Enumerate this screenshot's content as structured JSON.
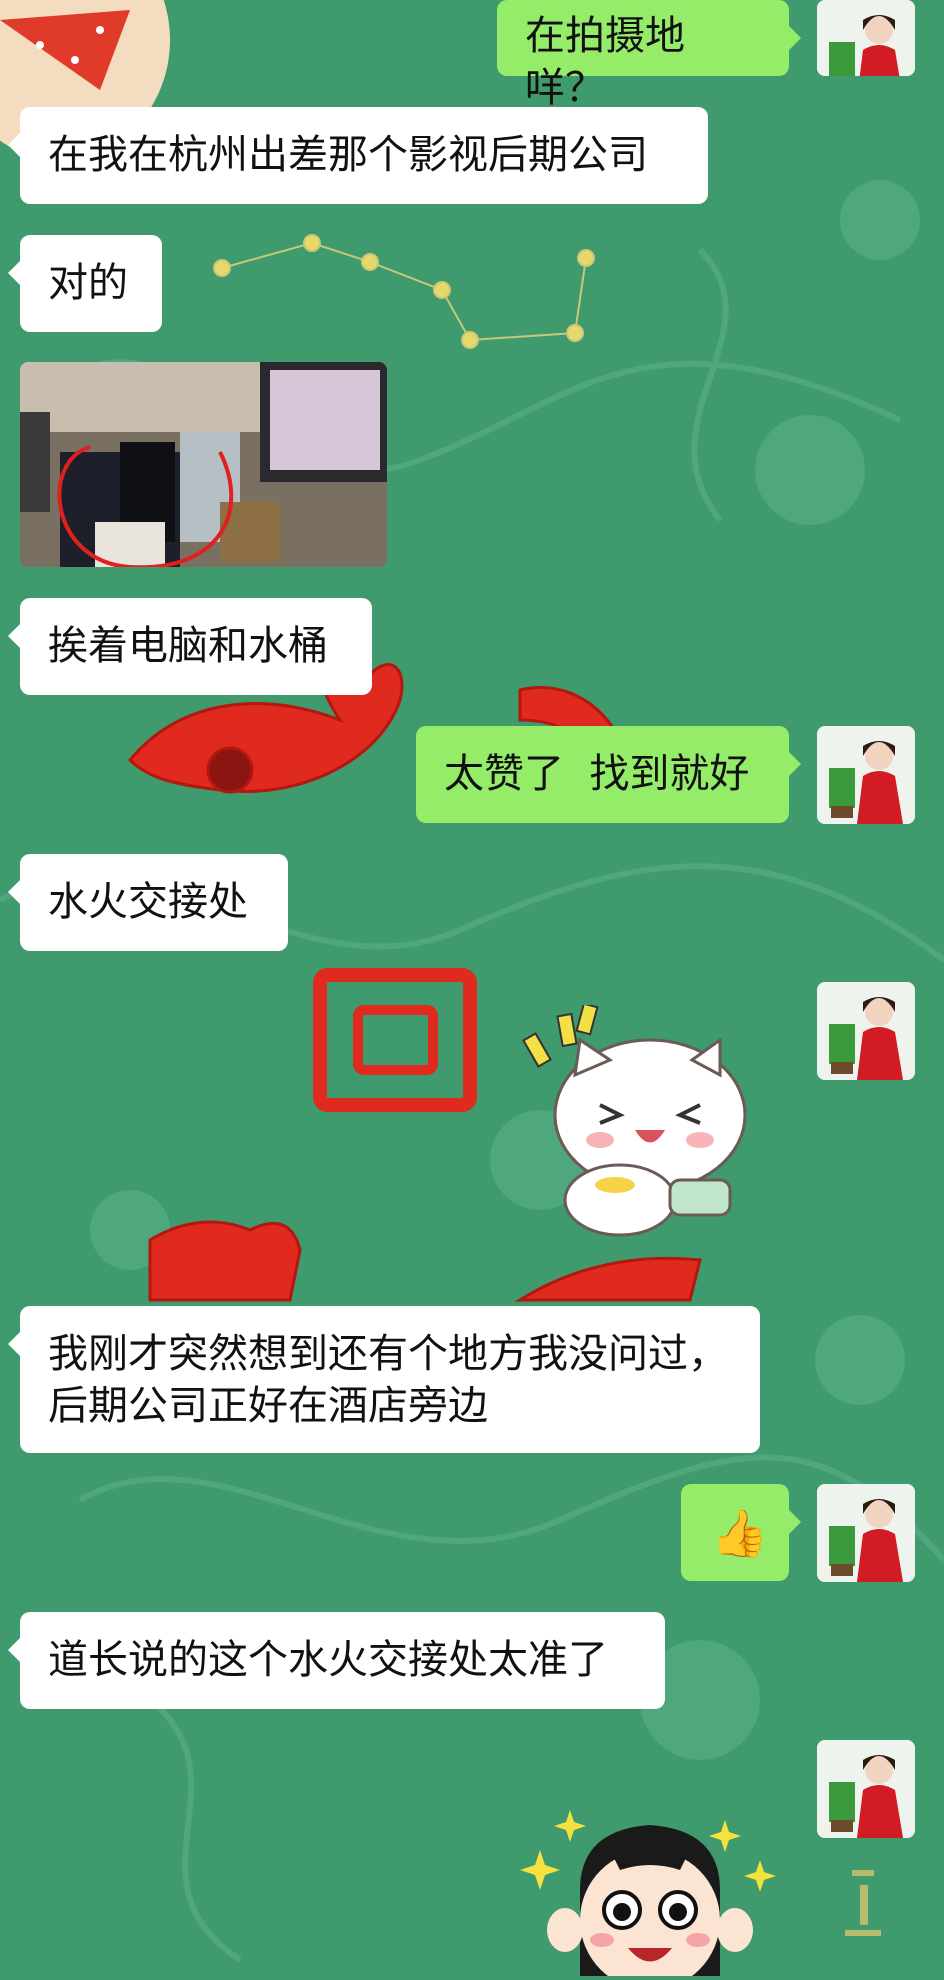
{
  "chat": {
    "messages": [
      {
        "id": "m1",
        "side": "outgoing",
        "text": "在拍摄地咩？"
      },
      {
        "id": "m2",
        "side": "incoming",
        "text": "在我在杭州出差那个影视后期公司"
      },
      {
        "id": "m3",
        "side": "incoming",
        "text": "对的"
      },
      {
        "id": "m4",
        "side": "incoming",
        "type": "image",
        "description_icon": "photo-thumbnail"
      },
      {
        "id": "m5",
        "side": "incoming",
        "text": "挨着电脑和水桶"
      },
      {
        "id": "m6",
        "side": "outgoing",
        "text": "太赞了  找到就好"
      },
      {
        "id": "m7",
        "side": "incoming",
        "text": "水火交接处"
      },
      {
        "id": "m8",
        "side": "outgoing",
        "type": "sticker",
        "icon": "cat-sticker"
      },
      {
        "id": "m9",
        "side": "incoming",
        "text": "我刚才突然想到还有个地方我没问过，\n后期公司正好在酒店旁边"
      },
      {
        "id": "m10",
        "side": "outgoing",
        "type": "emoji",
        "icon": "thumbs-up-icon",
        "text": "👍"
      },
      {
        "id": "m11",
        "side": "incoming",
        "text": "道长说的这个水火交接处太准了"
      },
      {
        "id": "m12",
        "side": "outgoing",
        "type": "sticker",
        "icon": "boy-face-sticker"
      }
    ]
  },
  "colors": {
    "background": "#3f9a6e",
    "incoming_bubble": "#ffffff",
    "outgoing_bubble": "#95ec69",
    "wallpaper_red": "#e0291f"
  }
}
